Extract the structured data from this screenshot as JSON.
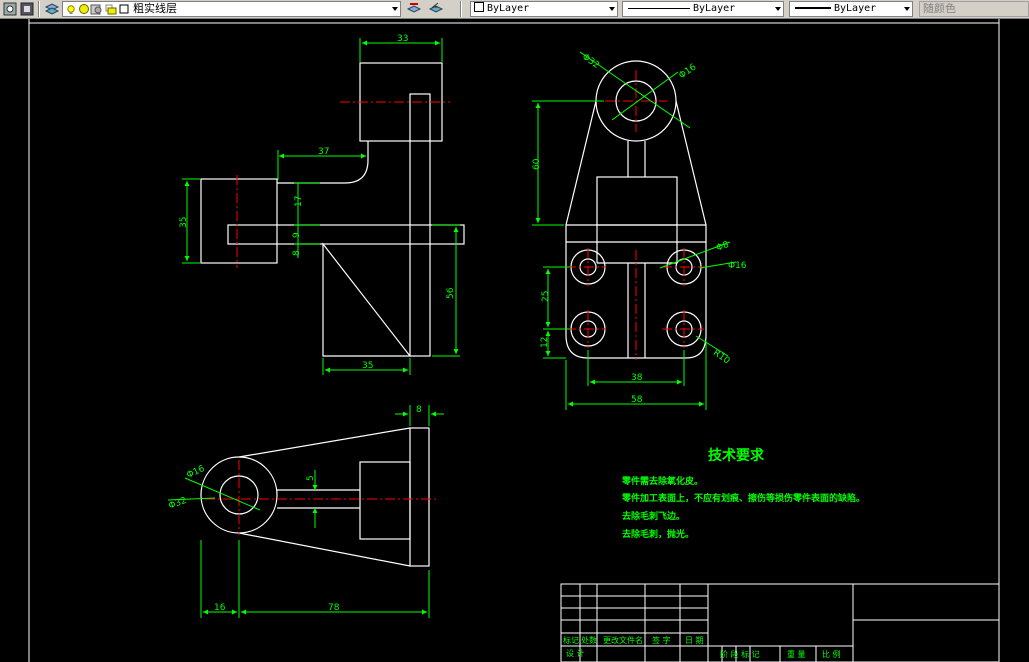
{
  "toolbar": {
    "layer_value": "粗实线层",
    "color_value": "ByLayer",
    "linetype_value": "ByLayer",
    "lineweight_value": "ByLayer",
    "plotstyle_value": "随颜色"
  },
  "drawing": {
    "dims": {
      "d33": "33",
      "d37": "37",
      "d35v": "35",
      "d17": "17",
      "d9": "9",
      "d8": "8",
      "d56": "56",
      "d35h": "35",
      "d60": "60",
      "d25": "25",
      "d12": "12",
      "d38": "38",
      "d58": "58",
      "d8top": "8",
      "d16": "16",
      "d78": "78",
      "d5": "5"
    },
    "diams": {
      "phi32a": "Φ32",
      "phi16a": "Φ16",
      "phi8": "Φ8",
      "phi16b": "Φ16",
      "r10": "R10",
      "phi16c": "Φ16",
      "phi32b": "Φ32"
    },
    "tech_title": "技术要求",
    "tech_lines": [
      "零件需去除氧化皮。",
      "零件加工表面上，不应有划痕、擦伤等损伤零件表面的缺陷。",
      "去除毛刺飞边。",
      "去除毛刺，抛光。"
    ],
    "title_block": {
      "mark": "标记",
      "count": "处数",
      "change_doc": "更改文件名",
      "sign": "签 字",
      "date": "日 期",
      "design": "设 计",
      "stage_mark": "阶 段 标 记",
      "weight": "重 量",
      "scale": "比 例"
    }
  }
}
